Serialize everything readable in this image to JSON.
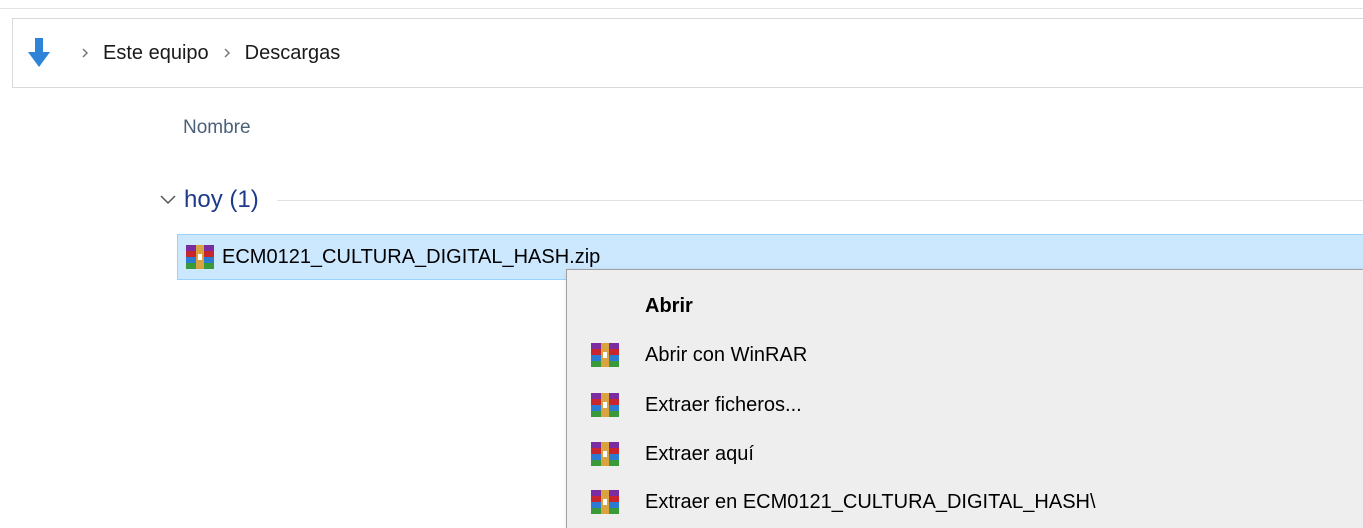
{
  "breadcrumb": {
    "items": [
      "Este equipo",
      "Descargas"
    ]
  },
  "columns": {
    "name_header": "Nombre"
  },
  "group": {
    "label": "hoy (1)"
  },
  "file": {
    "name": "ECM0121_CULTURA_DIGITAL_HASH.zip",
    "icon": "winrar-icon"
  },
  "context_menu": {
    "items": [
      {
        "label": "Abrir",
        "default": true,
        "icon": ""
      },
      {
        "label": "Abrir con WinRAR",
        "icon": "winrar-icon"
      },
      {
        "label": "Extraer ficheros...",
        "icon": "winrar-icon"
      },
      {
        "label": "Extraer aquí",
        "icon": "winrar-icon"
      },
      {
        "label": "Extraer en ECM0121_CULTURA_DIGITAL_HASH\\",
        "icon": "winrar-icon"
      }
    ]
  },
  "colors": {
    "selection_bg": "#cce8ff",
    "selection_border": "#99d1ff",
    "group_text": "#1e3a8a",
    "header_text": "#4c607a",
    "menu_bg": "#eeeeee",
    "nav_arrow": "#2f84d8"
  }
}
